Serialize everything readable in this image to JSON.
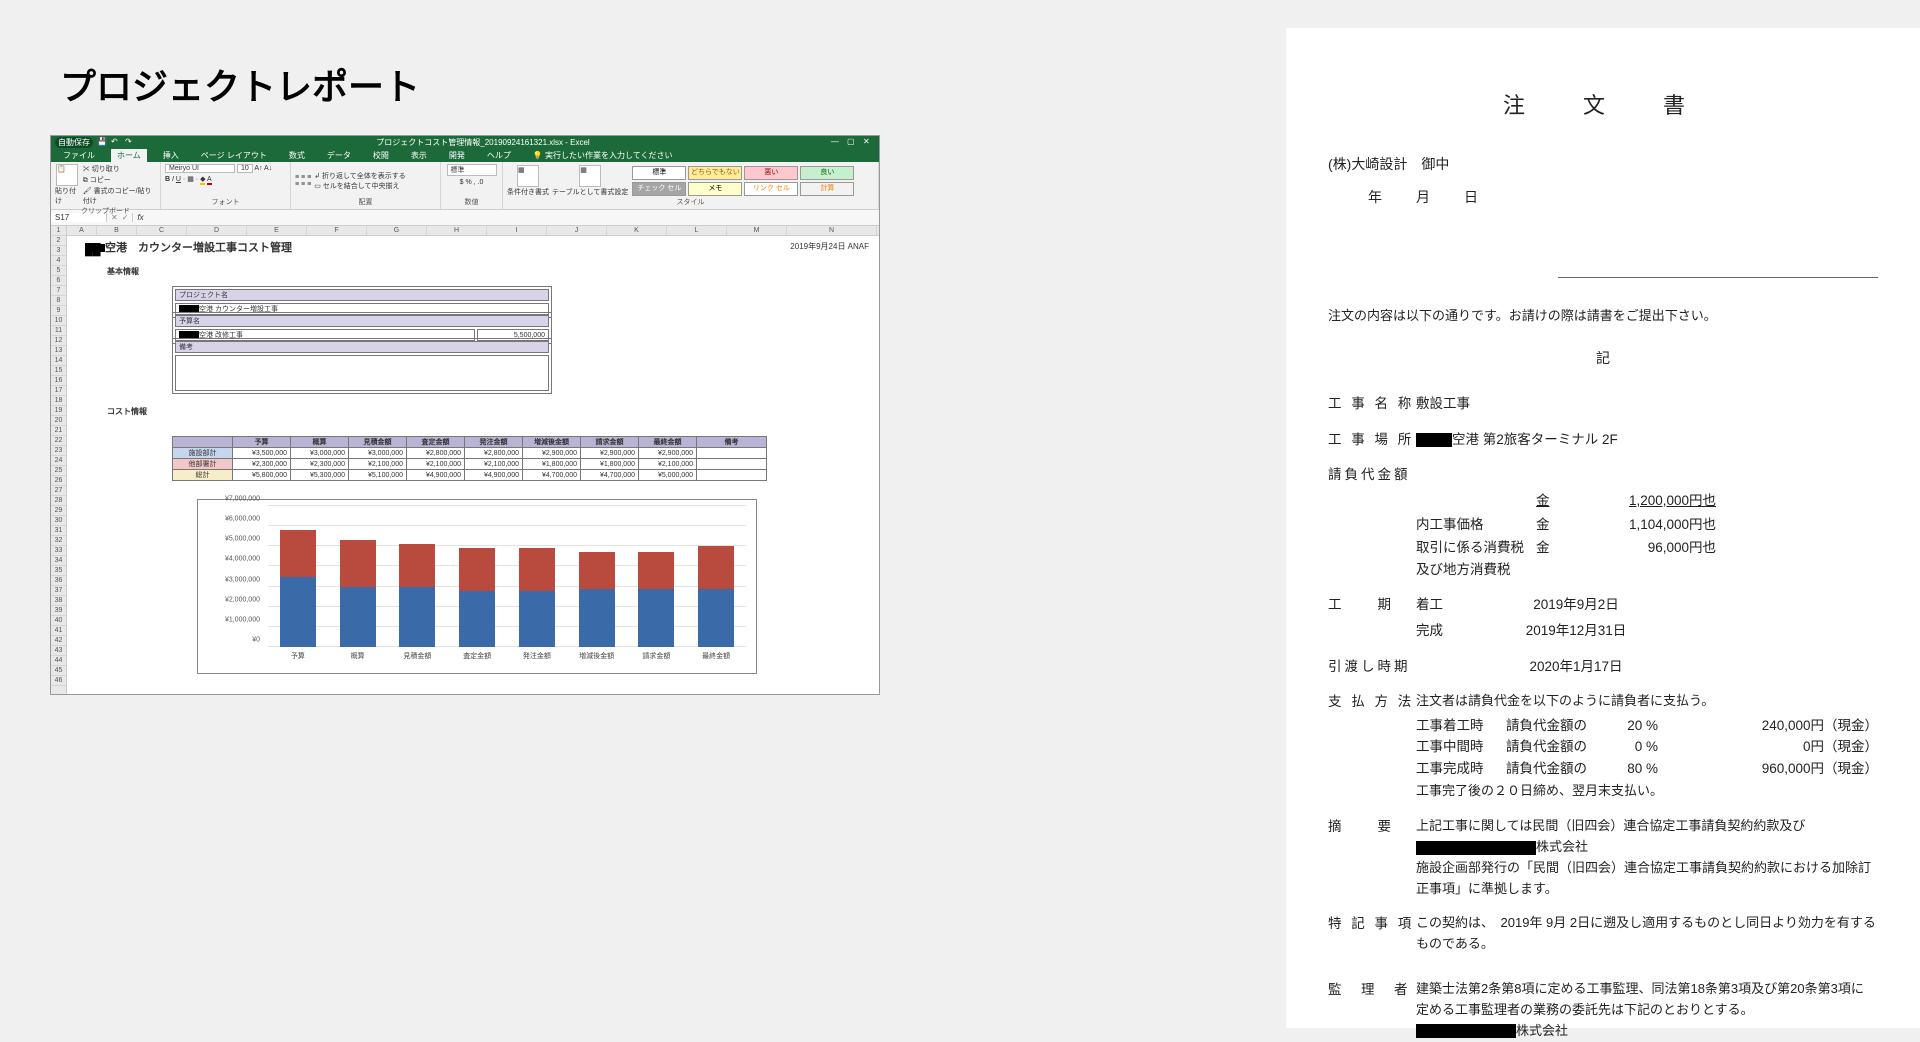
{
  "page_title": "プロジェクトレポート",
  "excel": {
    "filename": "プロジェクトコスト管理情報_20190924161321.xlsx - Excel",
    "autosave": "自動保存",
    "menus": [
      "ファイル",
      "ホーム",
      "挿入",
      "ページ レイアウト",
      "数式",
      "データ",
      "校閲",
      "表示",
      "開発",
      "ヘルプ"
    ],
    "tell_me": "実行したい作業を入力してください",
    "ribbon": {
      "clipboard": {
        "label": "クリップボード",
        "paste": "貼り付け",
        "cut": "切り取り",
        "copy": "コピー",
        "fmtpaint": "書式のコピー/貼り付け"
      },
      "font": {
        "label": "フォント",
        "name": "Meiryo UI",
        "size": "10"
      },
      "align": {
        "label": "配置",
        "wrap": "折り返して全体を表示する",
        "merge": "セルを結合して中央揃え"
      },
      "number": {
        "label": "数値",
        "fmt": "標準"
      },
      "styles": {
        "label": "スタイル",
        "condfmt": "条件付き書式",
        "astable": "テーブルとして書式設定",
        "cells": [
          {
            "t": "標準",
            "bg": "#ffffff",
            "c": "#000"
          },
          {
            "t": "どちらでもない",
            "bg": "#ffeb9c",
            "c": "#9c6500"
          },
          {
            "t": "悪い",
            "bg": "#ffc7ce",
            "c": "#9c0006"
          },
          {
            "t": "良い",
            "bg": "#c6efce",
            "c": "#006100"
          },
          {
            "t": "チェック セル",
            "bg": "#a5a5a5",
            "c": "#fff"
          },
          {
            "t": "メモ",
            "bg": "#ffffcc",
            "c": "#000"
          },
          {
            "t": "リンク セル",
            "bg": "#fff",
            "c": "#ff8001"
          },
          {
            "t": "計算",
            "bg": "#f2f2f2",
            "c": "#fa7d00"
          }
        ]
      }
    },
    "namebox": "S17",
    "sheet": {
      "title_suffix": "空港　カウンター増設工事コスト管理",
      "date": "2019年9月24日 ANAF",
      "sec_basic": "基本情報",
      "sec_cost": "コスト情報",
      "proj_label": "プロジェクト名",
      "proj_value": "空港 カウンター増設工事",
      "budget_label": "予算名",
      "budget_value": "空港 改修工事",
      "budget_amount": "5,500,000",
      "remark_label": "備考",
      "cost": {
        "cols": [
          "",
          "予算",
          "概算",
          "見積金額",
          "査定金額",
          "発注金額",
          "増減後金額",
          "請求金額",
          "最終金額",
          "備考"
        ],
        "rows": [
          {
            "label": "施設部計",
            "vals": [
              "¥3,500,000",
              "¥3,000,000",
              "¥3,000,000",
              "¥2,800,000",
              "¥2,800,000",
              "¥2,900,000",
              "¥2,900,000",
              "¥2,900,000",
              ""
            ]
          },
          {
            "label": "他部署計",
            "vals": [
              "¥2,300,000",
              "¥2,300,000",
              "¥2,100,000",
              "¥2,100,000",
              "¥2,100,000",
              "¥1,800,000",
              "¥1,800,000",
              "¥2,100,000",
              ""
            ]
          },
          {
            "label": "総計",
            "vals": [
              "¥5,800,000",
              "¥5,300,000",
              "¥5,100,000",
              "¥4,900,000",
              "¥4,900,000",
              "¥4,700,000",
              "¥4,700,000",
              "¥5,000,000",
              ""
            ]
          }
        ]
      }
    }
  },
  "order": {
    "title": "注　文　書",
    "recipient": "(株)大崎設計　御中",
    "dateline": "年　月　日",
    "lead": "注文の内容は以下の通りです。お請けの際は請書をご提出下さい。",
    "ki": "記",
    "name_label": "工 事 名 称",
    "name_value": "敷設工事",
    "place_label": "工 事 場 所",
    "place_value_suffix": "空港 第2旅客ターミナル 2F",
    "price_label": "請負代金額",
    "price_lines": [
      {
        "lab": "",
        "kin": "金",
        "amt": "1,200,000円也",
        "u": true
      },
      {
        "lab": "内工事価格",
        "kin": "金",
        "amt": "1,104,000円也"
      },
      {
        "lab": "取引に係る消費税及び地方消費税",
        "kin": "金",
        "amt": "96,000円也"
      }
    ],
    "period_label": "工　　期",
    "period_start_l": "着工",
    "period_start_v": "2019年9月2日",
    "period_end_l": "完成",
    "period_end_v": "2019年12月31日",
    "handover_label": "引渡し時期",
    "handover_value": "2020年1月17日",
    "pay_label": "支 払 方 法",
    "pay_lead": "注文者は請負代金を以下のように請負者に支払う。",
    "pay_lines": [
      {
        "c1": "工事着工時",
        "c2": "請負代金額の",
        "c3": "20 %",
        "c4": "240,000円（現金）"
      },
      {
        "c1": "工事中間時",
        "c2": "請負代金額の",
        "c3": "0 %",
        "c4": "0円（現金）"
      },
      {
        "c1": "工事完成時",
        "c2": "請負代金額の",
        "c3": "80 %",
        "c4": "960,000円（現金）"
      }
    ],
    "pay_note": "工事完了後の２０日締め、翌月末支払い。",
    "summary_label": "摘　　要",
    "summary_l1a": "上記工事に関しては民間（旧四会）連合協定工事請負契約約款及び",
    "summary_l1b": "株式会社",
    "summary_l2": "施設企画部発行の「民間（旧四会）連合協定工事請負契約約款における加除訂正事項」に準拠します。",
    "special_label": "特 記 事 項",
    "special_value": "この契約は、　2019年  9月  2日に遡及し適用するものとし同日より効力を有するものである。",
    "super_label": "監　理　者",
    "super_l1": "建築士法第2条第8項に定める工事監理、同法第18条第3項及び第20条第3項に",
    "super_l2": "定める工事監理者の業務の委託先は下記のとおりとする。",
    "super_l3": "株式会社"
  },
  "chart_data": {
    "type": "bar",
    "stacked": true,
    "categories": [
      "予算",
      "概算",
      "見積金額",
      "査定金額",
      "発注金額",
      "増減後金額",
      "請求金額",
      "最終金額"
    ],
    "series": [
      {
        "name": "施設部計",
        "color": "#3a6aa8",
        "values": [
          3500000,
          3000000,
          3000000,
          2800000,
          2800000,
          2900000,
          2900000,
          2900000
        ]
      },
      {
        "name": "他部署計",
        "color": "#b84a3e",
        "values": [
          2300000,
          2300000,
          2100000,
          2100000,
          2100000,
          1800000,
          1800000,
          2100000
        ]
      }
    ],
    "ylabel": "",
    "ylim": [
      0,
      7000000
    ],
    "yticks": [
      "¥0",
      "¥1,000,000",
      "¥2,000,000",
      "¥3,000,000",
      "¥4,000,000",
      "¥5,000,000",
      "¥6,000,000",
      "¥7,000,000"
    ]
  }
}
